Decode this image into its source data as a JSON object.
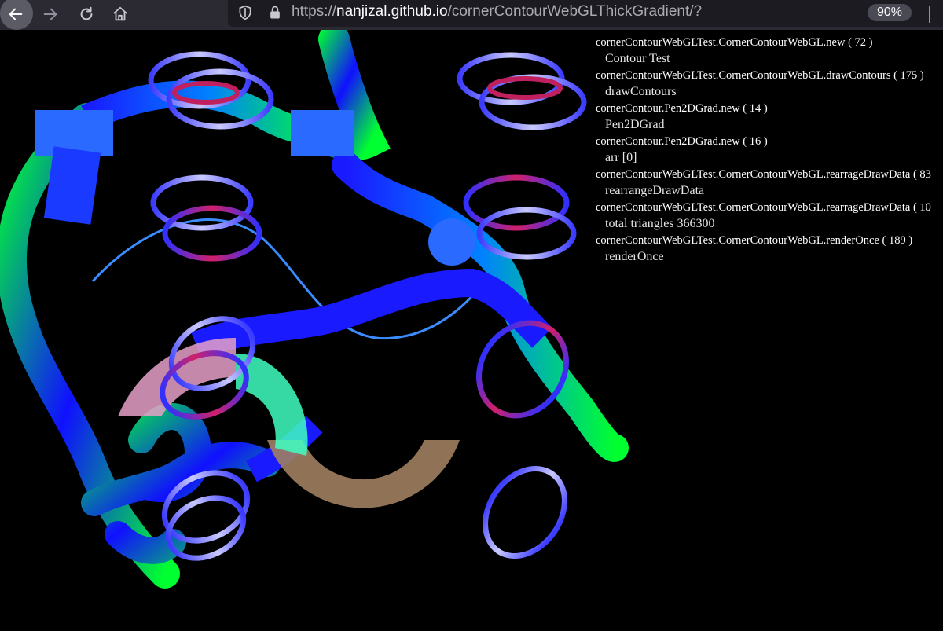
{
  "browser": {
    "url_prefix": "https://",
    "url_host": "nanjizal.github.io",
    "url_path": "/cornerContourWebGLThickGradient/?",
    "zoom": "90%",
    "icons": [
      "back-arrow-icon",
      "forward-arrow-icon",
      "reload-icon",
      "home-icon",
      "shield-icon",
      "lock-icon"
    ]
  },
  "console": {
    "entries": [
      {
        "source": "cornerContourWebGLTest.CornerContourWebGL.new ( 72 )",
        "message": "Contour Test"
      },
      {
        "source": "cornerContourWebGLTest.CornerContourWebGL.drawContours ( 175 )",
        "message": "drawContours"
      },
      {
        "source": "cornerContour.Pen2DGrad.new ( 14 )",
        "message": "Pen2DGrad"
      },
      {
        "source": "cornerContour.Pen2DGrad.new ( 16 )",
        "message": "arr [0]"
      },
      {
        "source": "cornerContourWebGLTest.CornerContourWebGL.rearrageDrawData ( 83",
        "message": "rearrangeDrawData"
      },
      {
        "source": "cornerContourWebGLTest.CornerContourWebGL.rearrageDrawData ( 10",
        "message": "total triangles 366300"
      },
      {
        "source": "cornerContourWebGLTest.CornerContourWebGL.renderOnce ( 189 )",
        "message": "renderOnce"
      }
    ]
  },
  "colors": {
    "toolbar": "#2b2a33",
    "urlbar": "#1c1b22",
    "canvas_bg": "#000000",
    "tube_green": "#00ff30",
    "tube_blue": "#1a1aff",
    "ring_light": "#c8c8ff",
    "ring_red": "#d0206a"
  }
}
